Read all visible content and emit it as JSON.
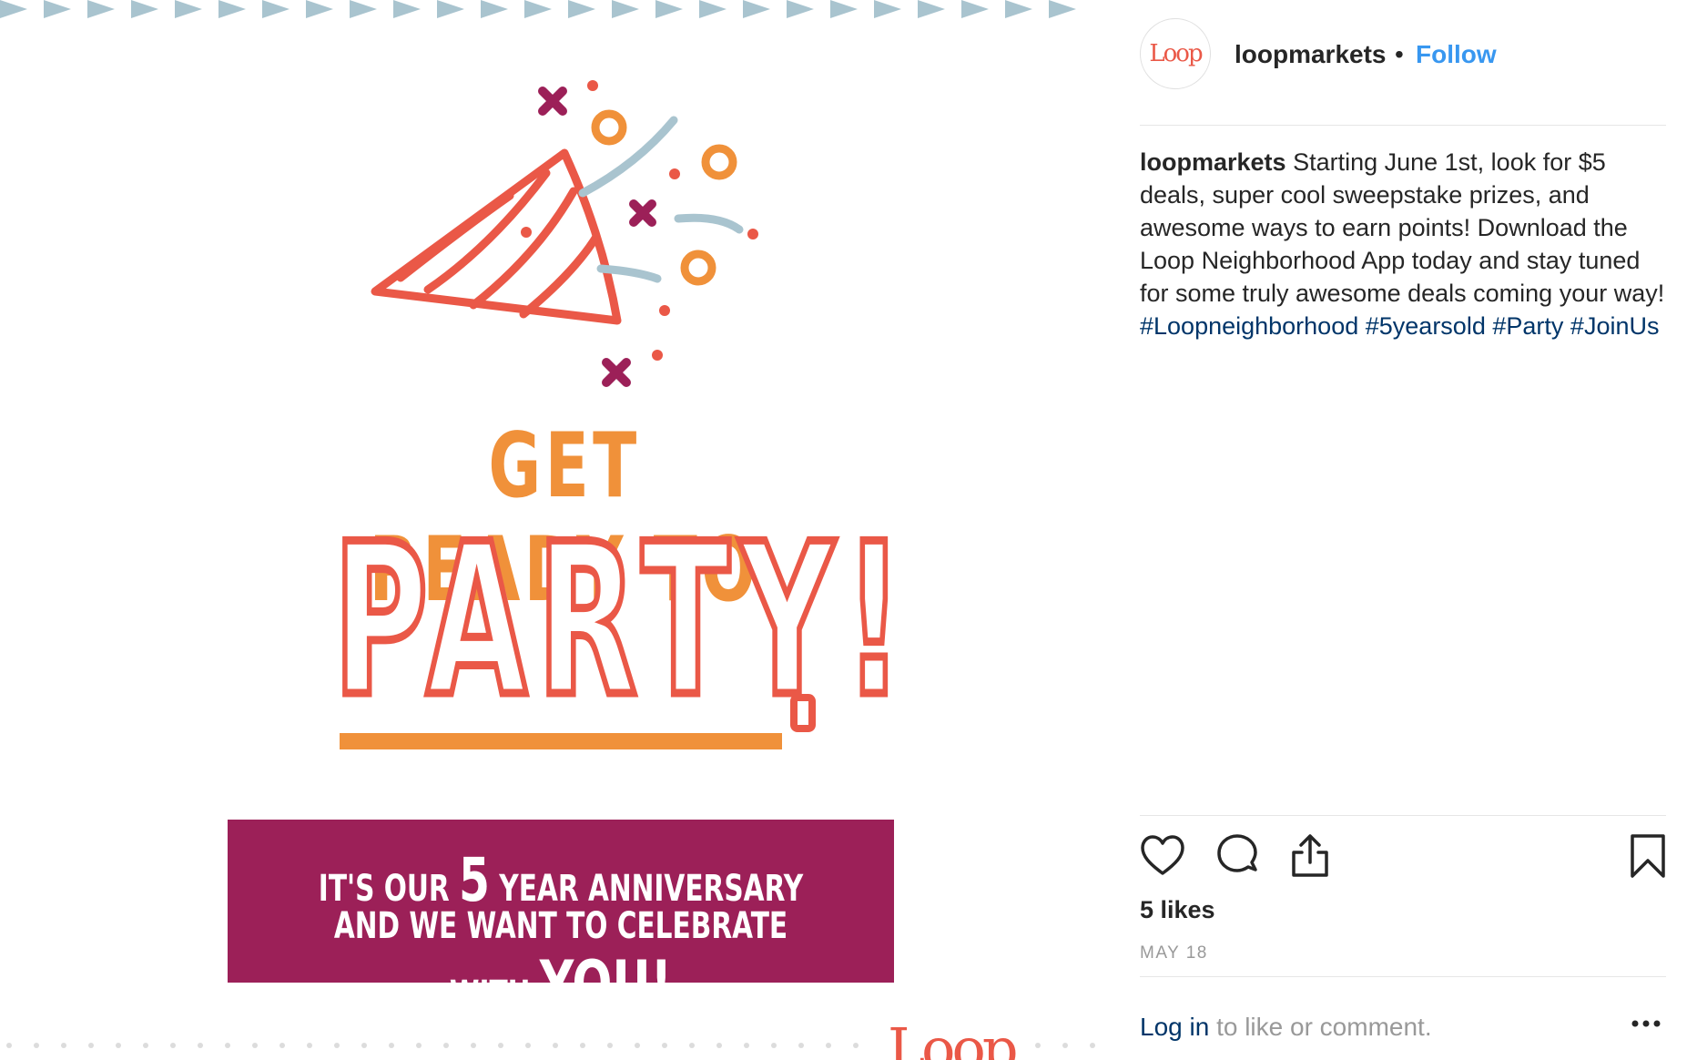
{
  "post": {
    "headline_1": "GET READY TO",
    "headline_2": "PARTY!",
    "banner_line1_a": "IT'S OUR ",
    "banner_line1_big": "5",
    "banner_line1_b": " YEAR ANNIVERSARY",
    "banner_line2_a": "AND WE WANT TO CELEBRATE WITH ",
    "banner_line2_big": "YOU!",
    "poster_logo": "Loop"
  },
  "header": {
    "avatar_logo": "Loop",
    "username": "loopmarkets",
    "separator": "•",
    "follow_label": "Follow"
  },
  "caption": {
    "username": "loopmarkets",
    "text": " Starting June 1st, look for $5 deals, super cool sweepstake prizes, and awesome ways to earn points! Download the Loop Neighborhood App today and stay tuned for some truly awesome deals coming your way! ",
    "hashtags": [
      "#Loopneighborhood",
      "#5yearsold",
      "#Party",
      "#JoinUs"
    ]
  },
  "actions": {
    "icons": [
      "heart-icon",
      "comment-icon",
      "share-icon",
      "bookmark-icon"
    ],
    "likes": "5 likes",
    "date": "MAY 18"
  },
  "footer": {
    "login_link": "Log in",
    "login_text": " to like or comment.",
    "more_icon": "more-icon"
  },
  "colors": {
    "follow": "#3897f0",
    "hashtag": "#003569",
    "party_red": "#ea5847",
    "party_orange": "#f0913a",
    "banner_magenta": "#9c2058",
    "bunting": "#a9c4cf"
  }
}
